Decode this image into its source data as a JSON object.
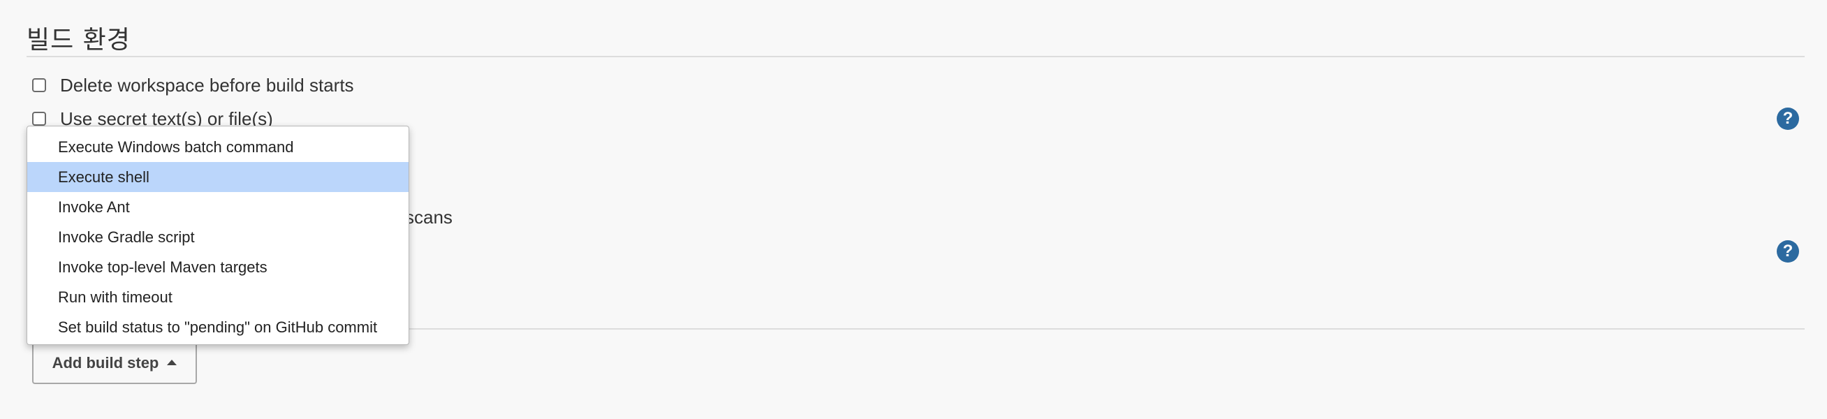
{
  "section": {
    "title": "빌드 환경"
  },
  "options": [
    {
      "label": "Delete workspace before build starts"
    },
    {
      "label": "Use secret text(s) or file(s)"
    }
  ],
  "hidden_partial": {
    "text": "scans"
  },
  "help": {
    "glyph": "?"
  },
  "dropdown": {
    "items": [
      {
        "label": "Execute Windows batch command"
      },
      {
        "label": "Execute shell"
      },
      {
        "label": "Invoke Ant"
      },
      {
        "label": "Invoke Gradle script"
      },
      {
        "label": "Invoke top-level Maven targets"
      },
      {
        "label": "Run with timeout"
      },
      {
        "label": "Set build status to \"pending\" on GitHub commit"
      }
    ],
    "selected_index": 1
  },
  "add_build_step": {
    "label": "Add build step",
    "icon": "caret-up-icon"
  },
  "colors": {
    "help_icon": "#2c6aa0",
    "menu_highlight": "#bbd6fb",
    "background": "#f8f8f8"
  }
}
